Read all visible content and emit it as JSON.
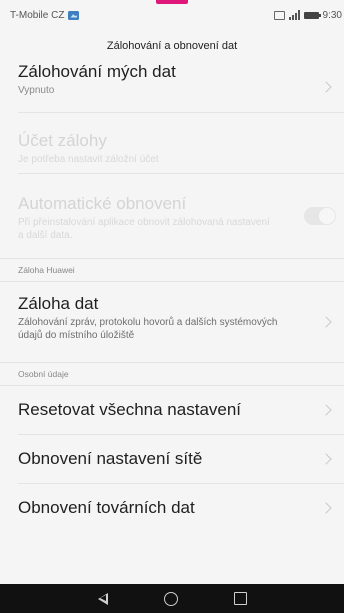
{
  "status_bar": {
    "carrier": "T-Mobile CZ",
    "time": "9:30",
    "icons": [
      "image-notification-icon",
      "vibrate-icon",
      "signal-icon",
      "battery-icon"
    ]
  },
  "header": {
    "title": "Zálohování a obnovení dat"
  },
  "backup_my_data": {
    "title": "Zálohování mých dat",
    "value": "Vypnuto"
  },
  "backup_account": {
    "title": "Účet zálohy",
    "subtitle": "Je potřeba nastavit záložní účet"
  },
  "auto_restore": {
    "title": "Automatické obnovení",
    "subtitle": "Při přeinstalování aplikace obnovit zálohovaná nastavení a další data.",
    "toggle_state": "off"
  },
  "section_huawei": {
    "label": "Záloha Huawei"
  },
  "data_backup": {
    "title": "Záloha dat",
    "subtitle": "Zálohování zpráv, protokolu hovorů a dalších systémových údajů do místního úložiště"
  },
  "section_personal": {
    "label": "Osobní údaje"
  },
  "reset_all": {
    "title": "Resetovat všechna nastavení"
  },
  "network_reset": {
    "title": "Obnovení nastavení sítě"
  },
  "factory_reset": {
    "title": "Obnovení továrních dat"
  },
  "navigation": {
    "icons": [
      "back-icon",
      "home-icon",
      "recent-apps-icon"
    ]
  },
  "colors": {
    "accent": "#e0177b",
    "nav_bar": "#111111",
    "background": "#f5f5f5"
  }
}
